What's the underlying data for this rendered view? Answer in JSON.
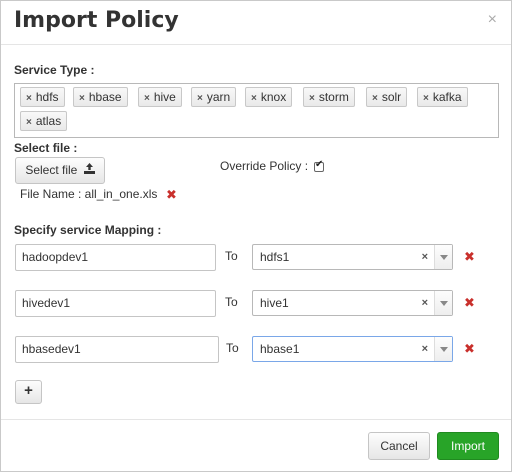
{
  "dialog": {
    "title": "Import Policy",
    "close_glyph": "×"
  },
  "service_type": {
    "label": "Service Type :",
    "tags": [
      "hdfs",
      "hbase",
      "hive",
      "yarn",
      "knox",
      "storm",
      "solr",
      "kafka",
      "atlas"
    ],
    "tag_remove_glyph": "×"
  },
  "select_file": {
    "label": "Select file :",
    "button_label": "Select file",
    "upload_icon": "upload-icon",
    "file_name_text": "File Name : all_in_one.xls",
    "remove_glyph": "✖"
  },
  "override": {
    "label": "Override Policy :",
    "checked": true
  },
  "mapping": {
    "label": "Specify service Mapping :",
    "to_label": "To",
    "rows": [
      {
        "source": "hadoopdev1",
        "target": "hdfs1"
      },
      {
        "source": "hivedev1",
        "target": "hive1"
      },
      {
        "source": "hbasedev1",
        "target": "hbase1"
      }
    ],
    "clear_glyph": "×",
    "remove_glyph": "✖",
    "add_glyph": "+"
  },
  "footer": {
    "cancel_label": "Cancel",
    "import_label": "Import"
  },
  "colors": {
    "import_button": "#27a327",
    "remove_red": "#c9302c",
    "focus_border": "#7aa7e8"
  }
}
